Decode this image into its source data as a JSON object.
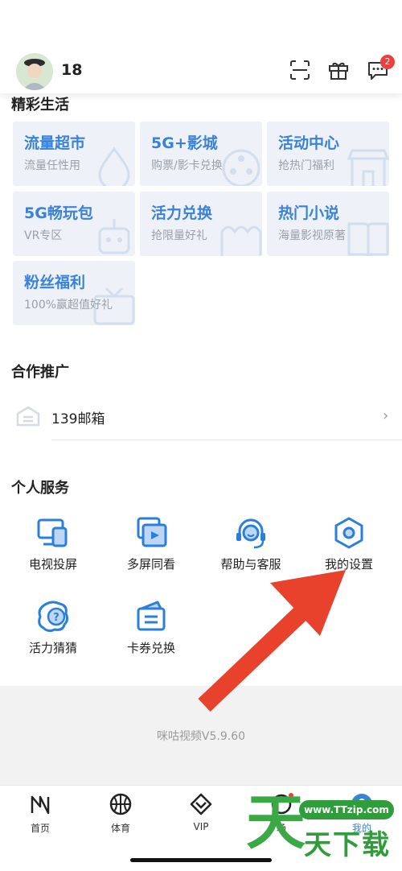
{
  "header": {
    "username": "18",
    "notification_count": "2",
    "icons": [
      "scan-icon",
      "gift-icon",
      "message-icon"
    ]
  },
  "life_section": {
    "title": "精彩生活",
    "tiles": [
      {
        "title": "流量超市",
        "subtitle": "流量任性用",
        "icon": "drop-icon"
      },
      {
        "title": "5G+影城",
        "subtitle": "购票/影卡兑换",
        "icon": "film-reel-icon"
      },
      {
        "title": "活动中心",
        "subtitle": "抢热门福利",
        "icon": "store-icon"
      },
      {
        "title": "5G畅玩包",
        "subtitle": "VR专区",
        "icon": "robot-icon"
      },
      {
        "title": "活力兑换",
        "subtitle": "抢限量好礼",
        "icon": "shop-icon"
      },
      {
        "title": "热门小说",
        "subtitle": "海量影视原著",
        "icon": "book-icon"
      },
      {
        "title": "粉丝福利",
        "subtitle": "100%赢超值好礼",
        "icon": "tv-icon"
      }
    ]
  },
  "promo_section": {
    "title": "合作推广",
    "items": [
      {
        "label": "139邮箱",
        "icon": "mail-icon"
      }
    ]
  },
  "service_section": {
    "title": "个人服务",
    "items": [
      {
        "label": "电视投屏",
        "icon": "cast-icon"
      },
      {
        "label": "多屏同看",
        "icon": "multi-screen-icon"
      },
      {
        "label": "帮助与客服",
        "icon": "headset-icon"
      },
      {
        "label": "我的设置",
        "icon": "settings-icon"
      },
      {
        "label": "活力猜猜",
        "icon": "question-icon"
      },
      {
        "label": "卡券兑换",
        "icon": "coupon-icon"
      }
    ]
  },
  "version": "咪咕视频V5.9.60",
  "tabbar": {
    "tabs": [
      {
        "label": "首页",
        "icon": "home-icon"
      },
      {
        "label": "体育",
        "icon": "basketball-icon"
      },
      {
        "label": "VIP",
        "icon": "vip-icon"
      },
      {
        "label": "场",
        "icon": "arena-icon"
      },
      {
        "label": "我的",
        "icon": "profile-icon"
      }
    ]
  },
  "watermark": {
    "url": "www.TTzip.com",
    "big": "天",
    "text": "天下载"
  },
  "colors": {
    "accent": "#3a82d8",
    "tile_bg": "#eef2f8",
    "badge": "#ee3f3f",
    "arrow": "#e8412c",
    "watermark_green": "#2f9e3a"
  }
}
